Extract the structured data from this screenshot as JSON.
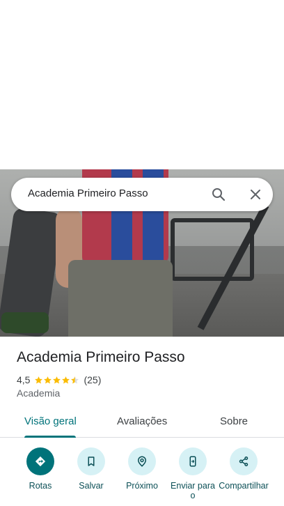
{
  "search": {
    "query": "Academia Primeiro Passo"
  },
  "place": {
    "name": "Academia Primeiro Passo",
    "rating": "4,5",
    "stars": 4.5,
    "reviews": "(25)",
    "category": "Academia"
  },
  "tabs": [
    {
      "label": "Visão geral",
      "active": true
    },
    {
      "label": "Avaliações",
      "active": false
    },
    {
      "label": "Sobre",
      "active": false
    }
  ],
  "actions": [
    {
      "label": "Rotas",
      "icon": "directions-icon"
    },
    {
      "label": "Salvar",
      "icon": "bookmark-icon"
    },
    {
      "label": "Próximo",
      "icon": "nearby-icon"
    },
    {
      "label": "Enviar para o",
      "icon": "send-to-phone-icon"
    },
    {
      "label": "Compartilhar",
      "icon": "share-icon"
    }
  ],
  "colors": {
    "accent": "#00737a",
    "star": "#fbbc04",
    "action_bg": "#d6f1f5"
  }
}
